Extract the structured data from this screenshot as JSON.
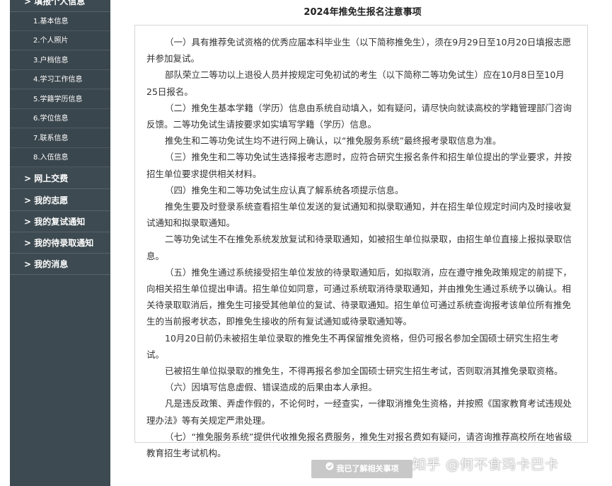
{
  "sidebar": {
    "group_title": "> 填报个人信息",
    "sub_items": [
      {
        "label": "1.基本信息"
      },
      {
        "label": "2.个人照片"
      },
      {
        "label": "3.户档信息"
      },
      {
        "label": "4.学习工作信息"
      },
      {
        "label": "5.学籍学历信息"
      },
      {
        "label": "6.学位信息"
      },
      {
        "label": "7.联系信息"
      },
      {
        "label": "8.入伍信息"
      }
    ],
    "main_items": [
      {
        "label": "> 网上交费"
      },
      {
        "label": "> 我的志愿"
      },
      {
        "label": "> 我的复试通知"
      },
      {
        "label": "> 我的待录取通知"
      },
      {
        "label": "> 我的消息"
      }
    ]
  },
  "main": {
    "title": "2024年推免生报名注意事项",
    "paragraphs": [
      "（一）具有推荐免试资格的优秀应届本科毕业生（以下简称推免生），须在9月29日至10月20日填报志愿并参加复试。",
      "部队荣立二等功以上退役人员并按规定可免初试的考生（以下简称二等功免试生）应在10月8日至10月25日报名。",
      "（二）推免生基本学籍（学历）信息由系统自动填入，如有疑问，请尽快向就读高校的学籍管理部门咨询反馈。二等功免试生请按要求如实填写学籍（学历）信息。",
      "推免生和二等功免试生均不进行网上确认，以“推免服务系统”最终报考录取信息为准。",
      "（三）推免生和二等功免试生选择报考志愿时，应符合研究生报名条件和招生单位提出的学业要求，并按招生单位要求提供相关材料。",
      "（四）推免生和二等功免试生应认真了解系统各项提示信息。",
      "推免生要及时登录系统查看招生单位发送的复试通知和拟录取通知，并在招生单位规定时间内及时接收复试通知和拟录取通知。",
      "二等功免试生不在推免系统发放复试和待录取通知，如被招生单位拟录取，由招生单位直接上报拟录取信息。",
      "（五）推免生通过系统接受招生单位发放的待录取通知后，如拟取消，应在遵守推免政策规定的前提下，向相关招生单位提出申请。招生单位如同意，可通过系统取消待录取通知，并由推免生通过系统予以确认。相关待录取取消后，推免生可接受其他单位的复试、待录取通知。招生单位可通过系统查询报考该单位所有推免生的当前报考状态，即推免生接收的所有复试通知或待录取通知等。",
      "10月20日前仍未被招生单位录取的推免生不再保留推免资格，但仍可报名参加全国硕士研究生招生考试。",
      "已被招生单位拟录取的推免生，不得再报名参加全国硕士研究生招生考试，否则取消其推免录取资格。",
      "（六）因填写信息虚假、错误造成的后果由本人承担。",
      "凡是违反政策、弄虚作假的，不论何时，一经查实，一律取消推免生资格，并按照《国家教育考试违规处理办法》等有关规定严肃处理。",
      "（七）“推免服务系统”提供代收推免报名费服务，推免生对报名费如有疑问，请咨询推荐高校所在地省级教育招生考试机构。"
    ],
    "confirm_label": "我已了解相关事项"
  },
  "watermark": "知乎 @何不食玛卡巴卡",
  "colors": {
    "sidebar_bg": "#3d4a51",
    "button_bg": "#c8c8c8",
    "border": "#d6d6d6"
  },
  "icons": {
    "confirm": "check-circle-icon"
  }
}
